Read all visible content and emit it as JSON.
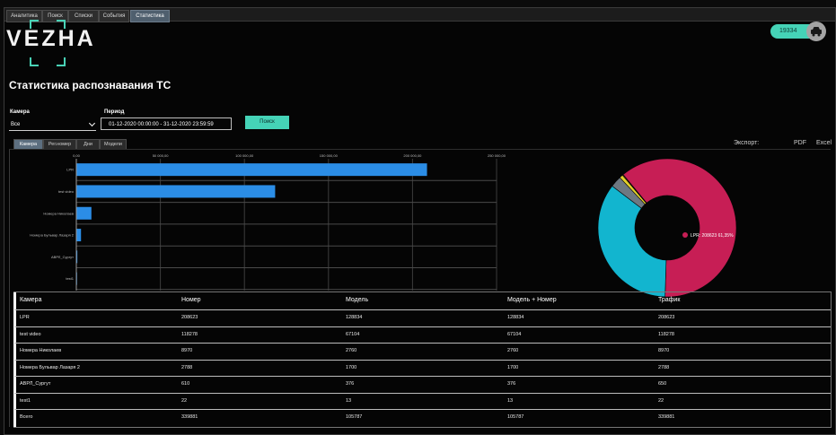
{
  "top_tabs": [
    "Аналитика",
    "Поиск",
    "Списки",
    "События",
    "Статистика"
  ],
  "top_active": 4,
  "logo_text": "VEZHA",
  "counter": "19334",
  "page_title": "Статистика распознавания ТС",
  "filters": {
    "camera_label": "Камера",
    "camera_value": "Все",
    "period_label": "Период",
    "period_value": "01-12-2020 00:00:00 - 31-12-2020 23:59:59",
    "search_label": "Поиск"
  },
  "view_tabs": [
    "Камера",
    "Рег.номер",
    "Дни",
    "Модели"
  ],
  "view_active": 0,
  "export": {
    "label": "Экспорт:",
    "pdf": "PDF",
    "excel": "Excel"
  },
  "chart_data": [
    {
      "type": "bar",
      "orientation": "horizontal",
      "categories": [
        "LPR",
        "test video",
        "Номера Николаев",
        "Номера Бульвар Лазаря 2",
        "АВРЛ_Сургут",
        "test1"
      ],
      "values": [
        208623,
        118278,
        8970,
        2788,
        610,
        22
      ],
      "xlim": [
        0,
        250000
      ],
      "ticks": [
        "0,00",
        "50 000,00",
        "100 000,00",
        "150 000,00",
        "200 000,00",
        "250 000,00"
      ],
      "grid": true,
      "color": "#2b8de6"
    },
    {
      "type": "pie",
      "variant": "donut",
      "labels": [
        "LPR",
        "test video",
        "Номера Николаев",
        "Номера Бульвар Лазаря 2",
        "АВРЛ_Сургут",
        "test1"
      ],
      "values": [
        208623,
        118278,
        8970,
        2788,
        610,
        22
      ],
      "colors": [
        "#c71e55",
        "#12b5cf",
        "#6e7881",
        "#e3d02a",
        "#f18d2e",
        "#8fbf3f"
      ],
      "callout": "LPR: 208623 61,35%"
    }
  ],
  "table": {
    "headers": [
      "Камера",
      "Номер",
      "Модель",
      "Модель + Номер",
      "Трафик"
    ],
    "rows": [
      [
        "LPR",
        "208623",
        "128834",
        "128834",
        "208623"
      ],
      [
        "test video",
        "118278",
        "67104",
        "67104",
        "118278"
      ],
      [
        "Номера Николаев",
        "8970",
        "2760",
        "2760",
        "8970"
      ],
      [
        "Номера Бульвар Лазаря 2",
        "2788",
        "1700",
        "1700",
        "2788"
      ],
      [
        "АВРЛ_Сургут",
        "610",
        "376",
        "376",
        "650"
      ],
      [
        "test1",
        "22",
        "13",
        "13",
        "22"
      ],
      [
        "Всего",
        "339881",
        "105787",
        "105787",
        "339881"
      ]
    ]
  },
  "colors": {
    "accent": "#45d3b7",
    "bar": "#2b8de6"
  }
}
